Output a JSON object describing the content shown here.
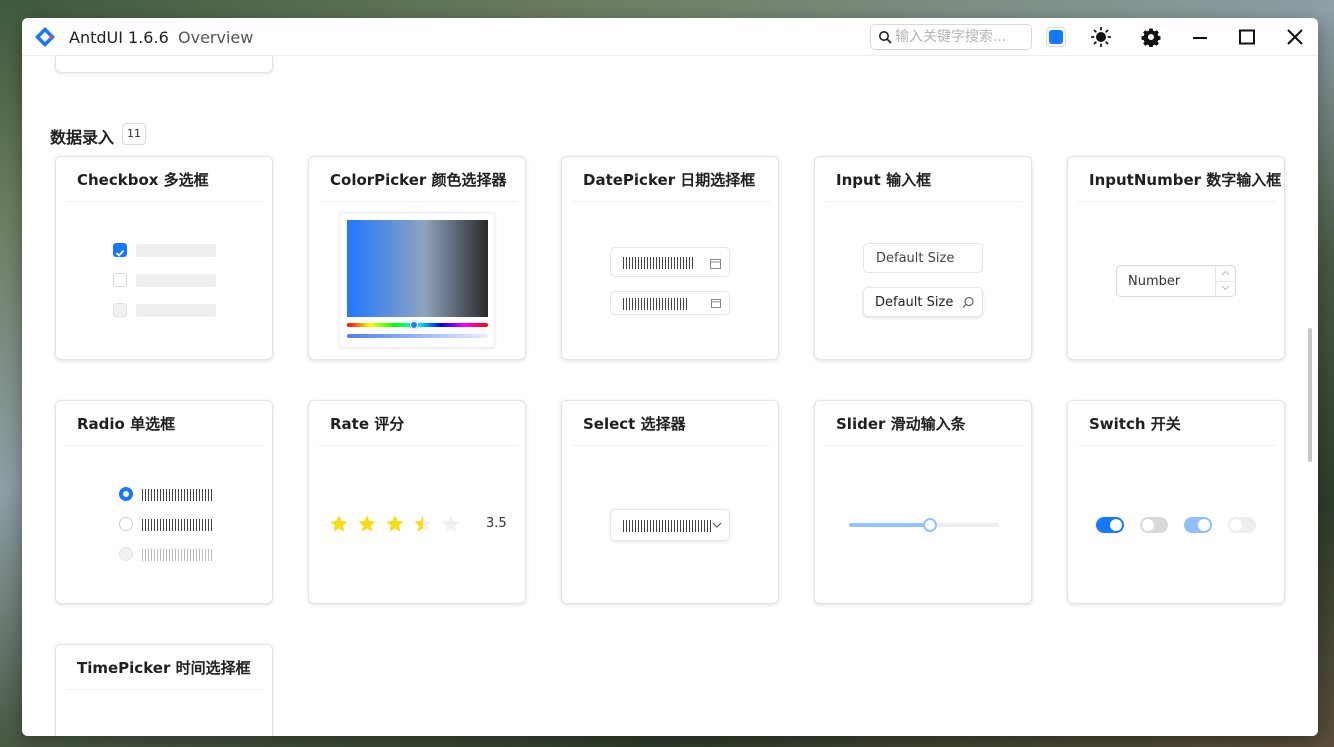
{
  "titlebar": {
    "app_title": "AntdUI 1.6.6",
    "subtitle": "Overview",
    "search_placeholder": "输入关键字搜索...",
    "accent_color": "#1677ff"
  },
  "section": {
    "title": "数据录入",
    "count": "11"
  },
  "cards": {
    "checkbox": "Checkbox 多选框",
    "colorpicker": "ColorPicker 颜色选择器",
    "datepicker": "DatePicker 日期选择框",
    "input": "Input 输入框",
    "inputnumber": "InputNumber 数字输入框",
    "radio": "Radio 单选框",
    "rate": "Rate 评分",
    "select": "Select 选择器",
    "slider": "Slider 滑动输入条",
    "switch": "Switch 开关",
    "timepicker": "TimePicker 时间选择框"
  },
  "input_demo": {
    "default_size_1": "Default Size",
    "default_size_2": "Default Size"
  },
  "inputnumber_demo": {
    "placeholder": "Number"
  },
  "rate_demo": {
    "value": "3.5",
    "max": 5
  },
  "slider_demo": {
    "value_fraction": 0.54
  },
  "icons": {
    "logo": "antdui-logo-icon",
    "search": "search-icon",
    "theme": "sun-icon",
    "settings": "gear-icon",
    "minimize": "minimize-icon",
    "maximize": "maximize-icon",
    "close": "close-icon"
  }
}
